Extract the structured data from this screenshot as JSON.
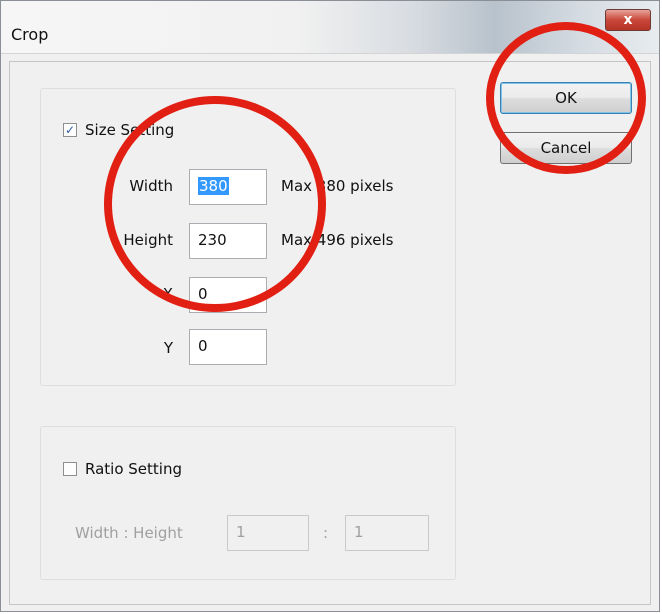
{
  "window": {
    "title": "Crop",
    "close_glyph": "x"
  },
  "buttons": {
    "ok_label": "OK",
    "cancel_label": "Cancel"
  },
  "size_setting": {
    "label": "Size Setting",
    "checked": true,
    "fields": [
      {
        "name": "width",
        "label": "Width",
        "value": "380",
        "max_text": "Max 380 pixels"
      },
      {
        "name": "height",
        "label": "Height",
        "value": "230",
        "max_text": "Max 496 pixels"
      },
      {
        "name": "x",
        "label": "X",
        "value": "0"
      },
      {
        "name": "y",
        "label": "Y",
        "value": "0"
      }
    ]
  },
  "ratio_setting": {
    "label": "Ratio Setting",
    "checked": false,
    "ratio_label": "Width : Height",
    "width_value": "1",
    "separator": ":",
    "height_value": "1"
  },
  "annotation_color": "#e21f13",
  "icons": {
    "check": "checkmark-icon",
    "close": "close-icon"
  }
}
